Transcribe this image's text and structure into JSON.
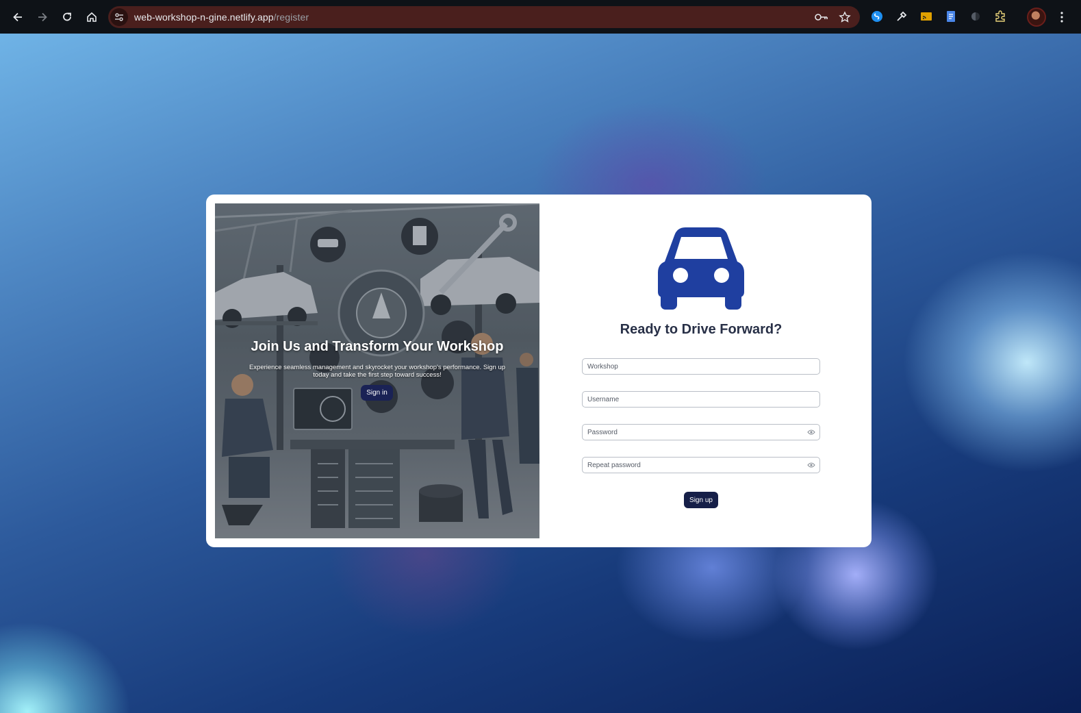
{
  "browser": {
    "url_host": "web-workshop-n-gine.netlify.app",
    "url_path": "/register"
  },
  "colors": {
    "brand_blue": "#1f3fa0",
    "button_dark": "#161f48",
    "title_text": "#283047"
  },
  "hero": {
    "headline": "Join Us and Transform Your Workshop",
    "subtext": "Experience seamless management and skyrocket your workshop's performance. Sign up today and take the first step toward success!",
    "signin_label": "Sign in"
  },
  "form": {
    "logo_icon": "car-icon",
    "title": "Ready to Drive Forward?",
    "fields": {
      "workshop_placeholder": "Workshop",
      "username_placeholder": "Username",
      "password_placeholder": "Password",
      "repeat_password_placeholder": "Repeat password"
    },
    "signup_label": "Sign up"
  }
}
